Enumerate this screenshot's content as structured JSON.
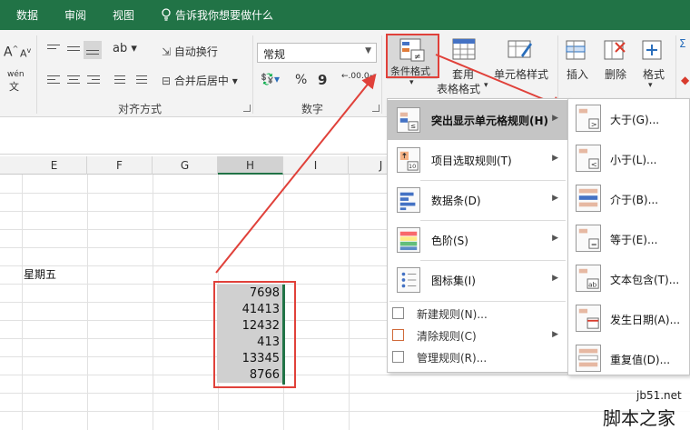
{
  "tabs": [
    "数据",
    "审阅",
    "视图"
  ],
  "tell_me": "告诉我你想要做什么",
  "ribbon": {
    "wrap_text": "自动换行",
    "merge_center": "合并后居中",
    "number_format": "常规",
    "percent": "%",
    "comma": "9",
    "dec_increase": ".00",
    "dec_decrease": ".0",
    "conditional_format": "条件格式",
    "format_as_table_1": "套用",
    "format_as_table_2": "表格格式",
    "cell_styles": "单元格样式",
    "insert": "插入",
    "delete": "删除",
    "format": "格式",
    "group_alignment": "对齐方式",
    "group_number": "数字",
    "phonetic": "wén"
  },
  "columns": [
    "E",
    "F",
    "G",
    "H",
    "I",
    "J"
  ],
  "cell_e": "星期五",
  "values": [
    "7698",
    "41413",
    "12432",
    "413",
    "13345",
    "8766"
  ],
  "menu": {
    "items": [
      {
        "label": "突出显示单元格规则(H)",
        "has_sub": true
      },
      {
        "label": "项目选取规则(T)",
        "has_sub": true
      },
      {
        "label": "数据条(D)",
        "has_sub": true
      },
      {
        "label": "色阶(S)",
        "has_sub": true
      },
      {
        "label": "图标集(I)",
        "has_sub": true
      }
    ],
    "small_items": [
      {
        "label": "新建规则(N)..."
      },
      {
        "label": "清除规则(C)"
      },
      {
        "label": "管理规则(R)..."
      }
    ]
  },
  "submenu": [
    {
      "label": "大于(G)..."
    },
    {
      "label": "小于(L)..."
    },
    {
      "label": "介于(B)..."
    },
    {
      "label": "等于(E)..."
    },
    {
      "label": "文本包含(T)..."
    },
    {
      "label": "发生日期(A)..."
    },
    {
      "label": "重复值(D)..."
    }
  ],
  "watermark": {
    "url": "jb51.net",
    "text": "脚本之家"
  },
  "colors": {
    "accent": "#217346",
    "highlight": "#e0413a"
  }
}
